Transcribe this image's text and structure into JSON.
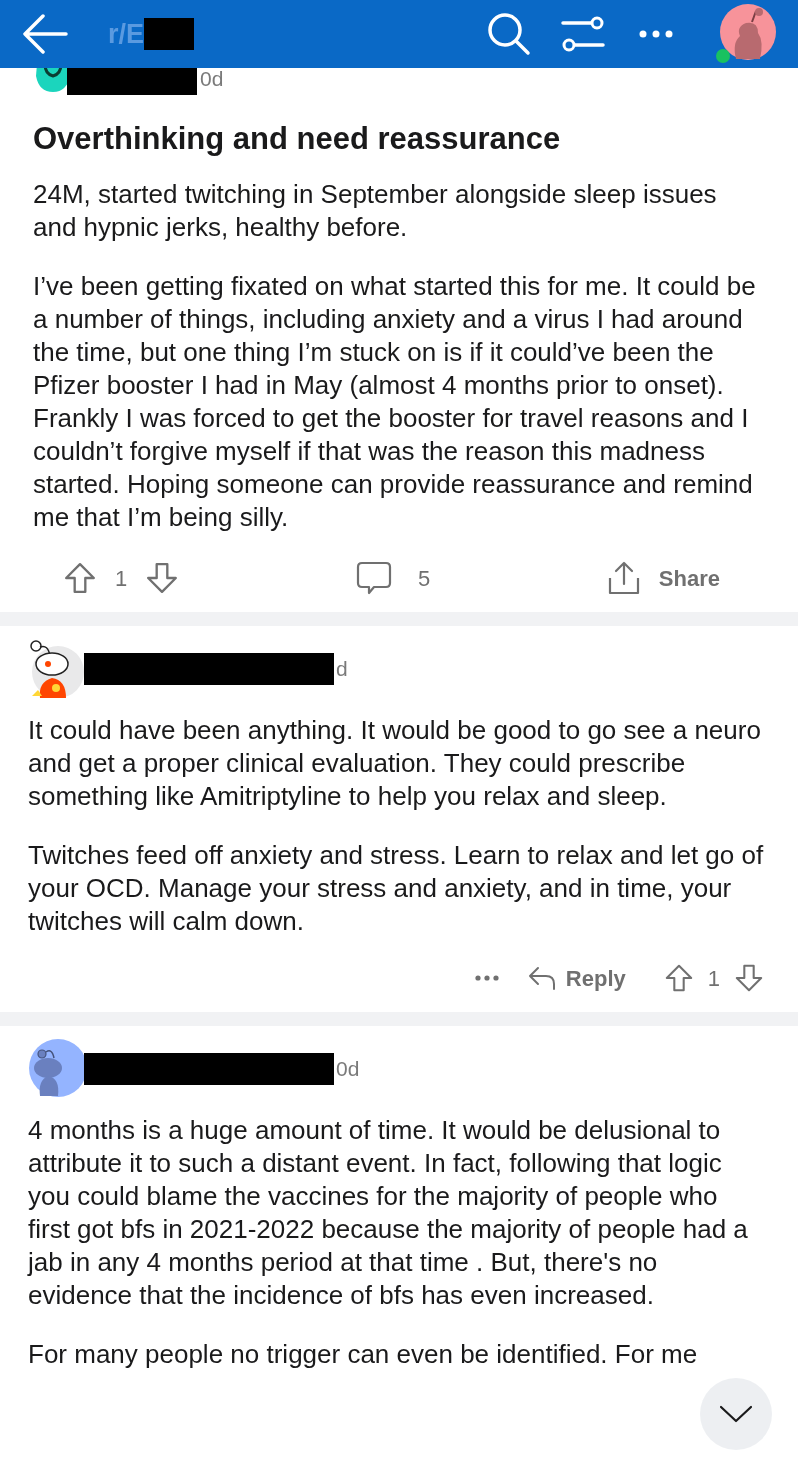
{
  "header": {
    "subreddit": "r/E",
    "subreddit_redacted": true
  },
  "post": {
    "author_redacted": true,
    "age": "0d",
    "title": "Overthinking and need reassurance",
    "paragraphs": [
      "24M, started twitching in September alongside sleep issues and hypnic jerks, healthy before.",
      "I’ve been getting fixated on what started this for me. It could be a number of things, including anxiety and a virus I had around the time, but one thing I’m stuck on is if it could’ve been the Pfizer booster I had in May (almost 4 months prior to onset). Frankly I was forced to get the booster for travel reasons and I couldn’t forgive myself if that was the reason this madness started. Hoping someone can provide reassurance and remind me that I’m being silly."
    ],
    "votes": "1",
    "comments": "5",
    "share": "Share"
  },
  "comments": [
    {
      "avatar": {
        "kind": "snoo_orange"
      },
      "author_redacted": true,
      "age": "d",
      "paragraphs": [
        "It could have been anything. It would be good to go see a neuro and get a proper clinical evaluation. They could prescribe something like Amitriptyline to help you relax and sleep.",
        "Twitches feed off anxiety and stress. Learn to relax and let go of your OCD. Manage your stress and anxiety, and in time, your twitches will calm down."
      ],
      "actions": {
        "reply": "Reply",
        "votes": "1"
      }
    },
    {
      "avatar": {
        "kind": "snoo_blue"
      },
      "author_redacted": true,
      "age": "0d",
      "paragraphs": [
        "4 months is a huge amount of time. It would be delusional to attribute it to such a distant event. In fact, following that logic you could blame the vaccines for the majority of people who first got bfs in 2021-2022 because the majority of people had a jab in any 4 months period at that time . But, there's no evidence that the incidence of bfs has even increased.",
        "For many people no trigger can even be identified. For me"
      ]
    }
  ]
}
